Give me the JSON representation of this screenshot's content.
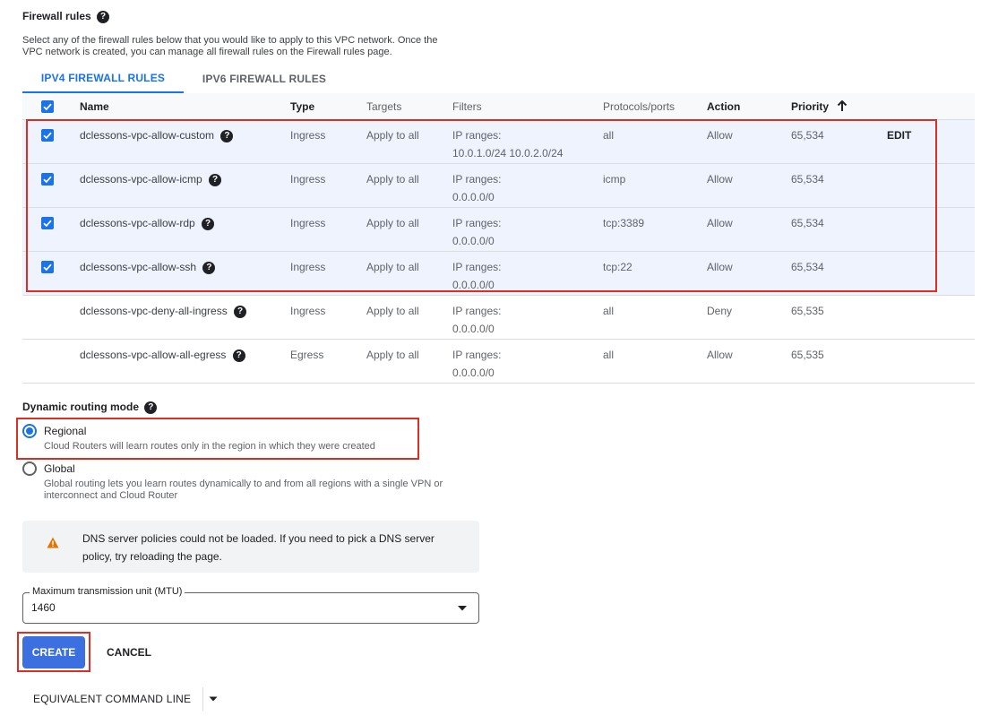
{
  "firewall": {
    "title": "Firewall rules",
    "description_line1": "Select any of the firewall rules below that you would like to apply to this VPC network. Once the",
    "description_line2": "VPC network is created, you can manage all firewall rules on the Firewall rules page.",
    "tabs": [
      {
        "label": "IPV4 FIREWALL RULES",
        "active": true
      },
      {
        "label": "IPV6 FIREWALL RULES",
        "active": false
      }
    ],
    "columns": {
      "name": "Name",
      "type": "Type",
      "targets": "Targets",
      "filters": "Filters",
      "protocols": "Protocols/ports",
      "action": "Action",
      "priority": "Priority"
    },
    "rows": [
      {
        "name": "dclessons-vpc-allow-custom",
        "type": "Ingress",
        "targets": "Apply to all",
        "filter_label": "IP ranges:",
        "filter_value": "10.0.1.0/24 10.0.2.0/24",
        "protocols": "all",
        "action": "Allow",
        "priority": "65,534",
        "edit": "EDIT",
        "checked": true
      },
      {
        "name": "dclessons-vpc-allow-icmp",
        "type": "Ingress",
        "targets": "Apply to all",
        "filter_label": "IP ranges:",
        "filter_value": "0.0.0.0/0",
        "protocols": "icmp",
        "action": "Allow",
        "priority": "65,534",
        "checked": true
      },
      {
        "name": "dclessons-vpc-allow-rdp",
        "type": "Ingress",
        "targets": "Apply to all",
        "filter_label": "IP ranges:",
        "filter_value": "0.0.0.0/0",
        "protocols": "tcp:3389",
        "action": "Allow",
        "priority": "65,534",
        "checked": true
      },
      {
        "name": "dclessons-vpc-allow-ssh",
        "type": "Ingress",
        "targets": "Apply to all",
        "filter_label": "IP ranges:",
        "filter_value": "0.0.0.0/0",
        "protocols": "tcp:22",
        "action": "Allow",
        "priority": "65,534",
        "checked": true
      },
      {
        "name": "dclessons-vpc-deny-all-ingress",
        "type": "Ingress",
        "targets": "Apply to all",
        "filter_label": "IP ranges:",
        "filter_value": "0.0.0.0/0",
        "protocols": "all",
        "action": "Deny",
        "priority": "65,535",
        "checked": false
      },
      {
        "name": "dclessons-vpc-allow-all-egress",
        "type": "Egress",
        "targets": "Apply to all",
        "filter_label": "IP ranges:",
        "filter_value": "0.0.0.0/0",
        "protocols": "all",
        "action": "Allow",
        "priority": "65,535",
        "checked": false
      }
    ]
  },
  "routing": {
    "title": "Dynamic routing mode",
    "options": [
      {
        "label": "Regional",
        "description": "Cloud Routers will learn routes only in the region in which they were created",
        "selected": true
      },
      {
        "label": "Global",
        "description_line1": "Global routing lets you learn routes dynamically to and from all regions with a single VPN or",
        "description_line2": "interconnect and Cloud Router",
        "selected": false
      }
    ]
  },
  "dns_warning": {
    "line1": "DNS server policies could not be loaded. If you need to pick a DNS server",
    "line2": "policy, try reloading the page."
  },
  "mtu": {
    "label": "Maximum transmission unit (MTU)",
    "value": "1460"
  },
  "actions": {
    "create": "CREATE",
    "cancel": "CANCEL",
    "equivalent": "EQUIVALENT COMMAND LINE"
  },
  "colors": {
    "accent": "#1a73e8",
    "highlight": "#d93025",
    "warning": "#e37400"
  }
}
